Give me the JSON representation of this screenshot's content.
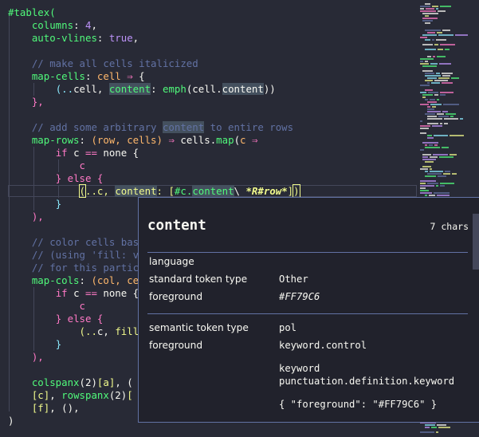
{
  "code_lines": [
    [
      {
        "t": "#tablex(",
        "c": "f"
      }
    ],
    [
      {
        "t": "    "
      },
      {
        "t": "columns",
        "c": "f"
      },
      {
        "t": ": ",
        "c": "t"
      },
      {
        "t": "4",
        "c": "v"
      },
      {
        "t": ",",
        "c": "t"
      }
    ],
    [
      {
        "t": "    "
      },
      {
        "t": "auto-vlines",
        "c": "f"
      },
      {
        "t": ": ",
        "c": "t"
      },
      {
        "t": "true",
        "c": "v"
      },
      {
        "t": ",",
        "c": "t"
      }
    ],
    [],
    [
      {
        "t": "    "
      },
      {
        "t": "// make all cells italicized",
        "c": "c"
      }
    ],
    [
      {
        "t": "    "
      },
      {
        "t": "map-cells",
        "c": "f"
      },
      {
        "t": ": ",
        "c": "t"
      },
      {
        "t": "cell",
        "c": "o"
      },
      {
        "t": " ",
        "c": "t"
      },
      {
        "t": "⇒",
        "c": "k"
      },
      {
        "t": " {",
        "c": "t"
      }
    ],
    [
      {
        "t": "        "
      },
      {
        "t": "(..",
        "c": "p"
      },
      {
        "t": "cell",
        "c": "t"
      },
      {
        "t": ", ",
        "c": "t"
      },
      {
        "t": "content",
        "c": "f",
        "hl": true
      },
      {
        "t": ": ",
        "c": "t"
      },
      {
        "t": "emph",
        "c": "f"
      },
      {
        "t": "(",
        "c": "t"
      },
      {
        "t": "cell",
        "c": "t"
      },
      {
        "t": ".",
        "c": "t"
      },
      {
        "t": "content",
        "c": "t",
        "hl": true
      },
      {
        "t": "))",
        "c": "t"
      }
    ],
    [
      {
        "t": "    "
      },
      {
        "t": "},",
        "c": "k"
      }
    ],
    [],
    [
      {
        "t": "    "
      },
      {
        "t": "// add some arbitrary ",
        "c": "c"
      },
      {
        "t": "content",
        "c": "c",
        "hl": true
      },
      {
        "t": " to entire rows",
        "c": "c"
      }
    ],
    [
      {
        "t": "    "
      },
      {
        "t": "map-rows",
        "c": "f"
      },
      {
        "t": ": ",
        "c": "t"
      },
      {
        "t": "(row, cells)",
        "c": "o"
      },
      {
        "t": " ",
        "c": "t"
      },
      {
        "t": "⇒",
        "c": "k"
      },
      {
        "t": " ",
        "c": "t"
      },
      {
        "t": "cells",
        "c": "t"
      },
      {
        "t": ".",
        "c": "t"
      },
      {
        "t": "map",
        "c": "f"
      },
      {
        "t": "(",
        "c": "t"
      },
      {
        "t": "c",
        "c": "o"
      },
      {
        "t": " ",
        "c": "t"
      },
      {
        "t": "⇒",
        "c": "k"
      }
    ],
    [
      {
        "t": "        "
      },
      {
        "t": "if",
        "c": "k"
      },
      {
        "t": " c ",
        "c": "t"
      },
      {
        "t": "==",
        "c": "k"
      },
      {
        "t": " none {",
        "c": "t"
      }
    ],
    [
      {
        "t": "            "
      },
      {
        "t": "c",
        "c": "k"
      }
    ],
    [
      {
        "t": "        "
      },
      {
        "t": "} else {",
        "c": "k"
      }
    ],
    [
      {
        "t": "            "
      },
      {
        "t": "(",
        "c": "s",
        "bm": true
      },
      {
        "t": "..c, ",
        "c": "s"
      },
      {
        "t": "content",
        "c": "s",
        "hl": true
      },
      {
        "t": ": [",
        "c": "s"
      },
      {
        "t": "#c.",
        "c": "f"
      },
      {
        "t": "content",
        "c": "f",
        "hl": true
      },
      {
        "t": "\\ ",
        "c": "t"
      },
      {
        "t": "*R#row*",
        "c": "s",
        "ib": true
      },
      {
        "t": "]",
        "c": "s"
      },
      {
        "t": ")",
        "c": "s",
        "bm": true
      }
    ],
    [
      {
        "t": "        "
      },
      {
        "t": "}",
        "c": "p"
      }
    ],
    [
      {
        "t": "    "
      },
      {
        "t": "),",
        "c": "k"
      }
    ],
    [],
    [
      {
        "t": "    "
      },
      {
        "t": "// color cells based on their values",
        "c": "c"
      }
    ],
    [
      {
        "t": "    "
      },
      {
        "t": "// (using 'fill: value' for specific cells)",
        "c": "c"
      }
    ],
    [
      {
        "t": "    "
      },
      {
        "t": "// for this particular example",
        "c": "c"
      }
    ],
    [
      {
        "t": "    "
      },
      {
        "t": "map-cols",
        "c": "f"
      },
      {
        "t": ": ",
        "c": "t"
      },
      {
        "t": "(col, cells)",
        "c": "o"
      },
      {
        "t": " ",
        "c": "t"
      },
      {
        "t": "⇒",
        "c": "k"
      }
    ],
    [
      {
        "t": "        "
      },
      {
        "t": "if",
        "c": "k"
      },
      {
        "t": " c ",
        "c": "t"
      },
      {
        "t": "==",
        "c": "k"
      },
      {
        "t": " none {",
        "c": "t"
      }
    ],
    [
      {
        "t": "            "
      },
      {
        "t": "c",
        "c": "k"
      }
    ],
    [
      {
        "t": "        "
      },
      {
        "t": "} else {",
        "c": "k"
      }
    ],
    [
      {
        "t": "            "
      },
      {
        "t": "(..",
        "c": "s"
      },
      {
        "t": "c, ",
        "c": "t"
      },
      {
        "t": "fill",
        "c": "s"
      },
      {
        "t": ": ",
        "c": "t"
      }
    ],
    [
      {
        "t": "        "
      },
      {
        "t": "}",
        "c": "p"
      }
    ],
    [
      {
        "t": "    "
      },
      {
        "t": "),",
        "c": "k"
      }
    ],
    [],
    [
      {
        "t": "    "
      },
      {
        "t": "colspanx",
        "c": "f"
      },
      {
        "t": "(2)",
        "c": "t"
      },
      {
        "t": "[a]",
        "c": "s"
      },
      {
        "t": ", (",
        "c": "t"
      }
    ],
    [
      {
        "t": "    "
      },
      {
        "t": "[c]",
        "c": "s"
      },
      {
        "t": ", ",
        "c": "t"
      },
      {
        "t": "rowspanx",
        "c": "f"
      },
      {
        "t": "(2)",
        "c": "t"
      },
      {
        "t": "[",
        "c": "s"
      }
    ],
    [
      {
        "t": "    "
      },
      {
        "t": "[f]",
        "c": "s"
      },
      {
        "t": ", (),",
        "c": "t"
      }
    ],
    [
      {
        "t": ")",
        "c": "t"
      }
    ]
  ],
  "hover": {
    "title": "content",
    "count": "7 chars",
    "language_label": "language",
    "token_type_label": "standard token type",
    "token_type_value": "Other",
    "foreground_label": "foreground",
    "foreground_value": "#FF79C6",
    "semantic_label": "semantic token type",
    "semantic_value": "pol",
    "foreground2_label": "foreground",
    "foreground2_value": "keyword.control",
    "scope1": "keyword",
    "scope2": "punctuation.definition.keyword",
    "json_value": "{ \"foreground\": \"#FF79C6\" }"
  },
  "colors": {
    "background": "#282a36",
    "keyword": "#ff79c6",
    "function": "#50fa7b",
    "number": "#bd93f9",
    "comment": "#6272a4",
    "string": "#f1fa8c",
    "parameter": "#ffb86c"
  }
}
